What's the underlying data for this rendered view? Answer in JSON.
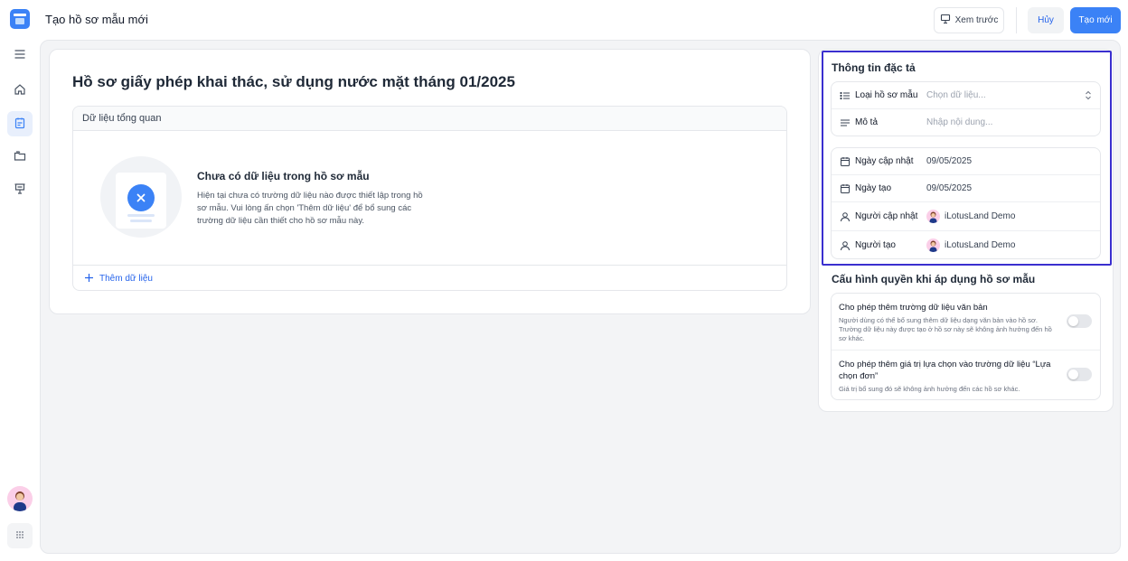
{
  "header": {
    "title": "Tạo hồ sơ mẫu mới",
    "preview_label": "Xem trước",
    "cancel_label": "Hủy",
    "create_label": "Tạo mới"
  },
  "sidebar": {
    "items": [
      {
        "icon": "menu-icon"
      },
      {
        "icon": "home-icon"
      },
      {
        "icon": "clipboard-icon",
        "active": true
      },
      {
        "icon": "folders-icon"
      },
      {
        "icon": "presentation-icon"
      }
    ]
  },
  "main": {
    "document_title": "Hồ sơ giấy phép khai thác, sử dụng nước mặt tháng 01/2025",
    "data_section": {
      "title": "Dữ liệu tổng quan",
      "empty_title": "Chưa có dữ liệu trong hồ sơ mẫu",
      "empty_description": "Hiện tại chưa có trường dữ liệu nào được thiết lập trong hồ sơ mẫu. Vui lòng ấn chọn 'Thêm dữ liệu' để bổ sung các trường dữ liệu cần thiết cho hồ sơ mẫu này.",
      "add_label": "Thêm dữ liệu"
    }
  },
  "spec": {
    "title": "Thông tin đặc tả",
    "template_type": {
      "label": "Loại hồ sơ mẫu",
      "placeholder": "Chọn dữ liệu..."
    },
    "description": {
      "label": "Mô tả",
      "placeholder": "Nhập nội dung..."
    },
    "updated_date": {
      "label": "Ngày cập nhật",
      "value": "09/05/2025"
    },
    "created_date": {
      "label": "Ngày tạo",
      "value": "09/05/2025"
    },
    "updated_by": {
      "label": "Người cập nhật",
      "value": "iLotusLand Demo"
    },
    "created_by": {
      "label": "Người tạo",
      "value": "iLotusLand Demo"
    }
  },
  "permissions": {
    "title": "Cấu hình quyền khi áp dụng hồ sơ mẫu",
    "items": [
      {
        "title": "Cho phép thêm trường dữ liệu văn bản",
        "description": "Người dùng có thể bổ sung thêm dữ liệu dạng văn bản vào hồ sơ. Trường dữ liệu này được tạo ở hồ sơ này sẽ không ảnh hưởng đến hồ sơ khác.",
        "enabled": false
      },
      {
        "title": "Cho phép thêm giá trị lựa chọn vào trường dữ liệu “Lựa chọn đơn”",
        "description": "Giá trị bổ sung đó sẽ không ảnh hưởng đến các hồ sơ khác.",
        "enabled": false
      }
    ]
  },
  "colors": {
    "accent": "#3b82f6",
    "highlight_border": "#3a2fcf"
  }
}
